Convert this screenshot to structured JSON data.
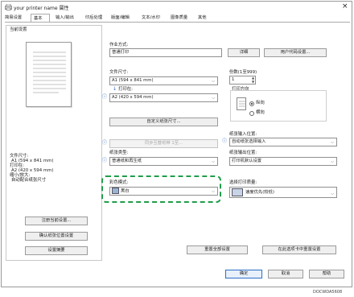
{
  "window": {
    "title": "your printer name 属性",
    "close": "×"
  },
  "tabs": [
    "简易设置",
    "基本",
    "输入/输出",
    "印后处理",
    "版面/编辑",
    "文本/水印",
    "图像质量",
    "其他"
  ],
  "left": {
    "section_label": "当前设置",
    "summary": [
      "文件尺寸:",
      "A1 (594 x 841 mm)",
      "打印在:",
      "A2 (420 x 594 mm)",
      "缩小/放大:",
      "自动配合纸张尺寸"
    ],
    "buttons": [
      "注册当前设置...",
      "确认纸张位置设置",
      "设置摘要"
    ]
  },
  "job": {
    "label": "作业方式:",
    "value": "普通打印",
    "details_button": "详细",
    "user_code_button": "用户代码设置..."
  },
  "doc_size": {
    "label": "文件尺寸:",
    "value": "A1 (594 x 841 mm)"
  },
  "print_on": {
    "label": "打印在:",
    "value": "A2 (420 x 594 mm)",
    "custom_button": "自定义纸张尺寸..."
  },
  "copies": {
    "label": "份数(1至999)",
    "value": "1"
  },
  "orientation": {
    "label": "打印方向",
    "options": [
      "纵向",
      "横向"
    ],
    "selected": "纵向"
  },
  "input_tray": {
    "label": "纸张输入位置:",
    "value": "自动纸张选择输入"
  },
  "same_size_button": "同步互替纸带 1至...",
  "paper_type": {
    "label": "纸张类型:",
    "value": "普通纸和再生纸"
  },
  "output_tray": {
    "label": "纸张输出位置:",
    "value": "打印机默认设置"
  },
  "color_mode": {
    "label": "彩色模式:",
    "value": "黑白"
  },
  "print_quality": {
    "label": "选择打印质量:",
    "value": "速度优先(较低)"
  },
  "bottom_buttons": {
    "reset": "重置全部设置",
    "reset_tab": "在此选项卡中重置设置"
  },
  "footer": {
    "ok": "确定",
    "cancel": "取消",
    "help": "帮助"
  },
  "figure_code": "DOCWDA5608",
  "colors": {
    "highlight": "#1f9e4a",
    "accent": "#2b6fc7"
  }
}
